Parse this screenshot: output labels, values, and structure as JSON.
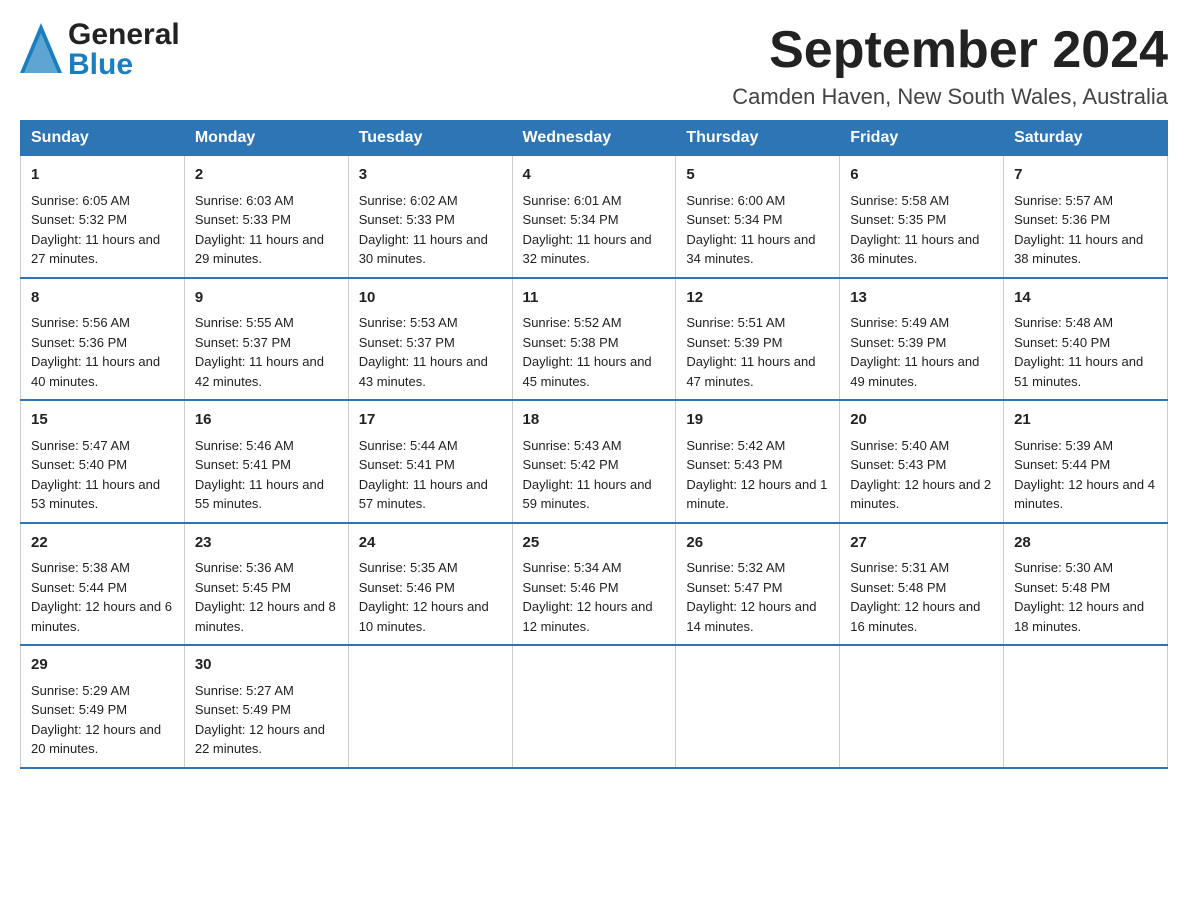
{
  "header": {
    "logo_general": "General",
    "logo_blue": "Blue",
    "month_title": "September 2024",
    "location": "Camden Haven, New South Wales, Australia"
  },
  "days_of_week": [
    "Sunday",
    "Monday",
    "Tuesday",
    "Wednesday",
    "Thursday",
    "Friday",
    "Saturday"
  ],
  "weeks": [
    [
      {
        "day": "1",
        "sunrise": "6:05 AM",
        "sunset": "5:32 PM",
        "daylight": "11 hours and 27 minutes."
      },
      {
        "day": "2",
        "sunrise": "6:03 AM",
        "sunset": "5:33 PM",
        "daylight": "11 hours and 29 minutes."
      },
      {
        "day": "3",
        "sunrise": "6:02 AM",
        "sunset": "5:33 PM",
        "daylight": "11 hours and 30 minutes."
      },
      {
        "day": "4",
        "sunrise": "6:01 AM",
        "sunset": "5:34 PM",
        "daylight": "11 hours and 32 minutes."
      },
      {
        "day": "5",
        "sunrise": "6:00 AM",
        "sunset": "5:34 PM",
        "daylight": "11 hours and 34 minutes."
      },
      {
        "day": "6",
        "sunrise": "5:58 AM",
        "sunset": "5:35 PM",
        "daylight": "11 hours and 36 minutes."
      },
      {
        "day": "7",
        "sunrise": "5:57 AM",
        "sunset": "5:36 PM",
        "daylight": "11 hours and 38 minutes."
      }
    ],
    [
      {
        "day": "8",
        "sunrise": "5:56 AM",
        "sunset": "5:36 PM",
        "daylight": "11 hours and 40 minutes."
      },
      {
        "day": "9",
        "sunrise": "5:55 AM",
        "sunset": "5:37 PM",
        "daylight": "11 hours and 42 minutes."
      },
      {
        "day": "10",
        "sunrise": "5:53 AM",
        "sunset": "5:37 PM",
        "daylight": "11 hours and 43 minutes."
      },
      {
        "day": "11",
        "sunrise": "5:52 AM",
        "sunset": "5:38 PM",
        "daylight": "11 hours and 45 minutes."
      },
      {
        "day": "12",
        "sunrise": "5:51 AM",
        "sunset": "5:39 PM",
        "daylight": "11 hours and 47 minutes."
      },
      {
        "day": "13",
        "sunrise": "5:49 AM",
        "sunset": "5:39 PM",
        "daylight": "11 hours and 49 minutes."
      },
      {
        "day": "14",
        "sunrise": "5:48 AM",
        "sunset": "5:40 PM",
        "daylight": "11 hours and 51 minutes."
      }
    ],
    [
      {
        "day": "15",
        "sunrise": "5:47 AM",
        "sunset": "5:40 PM",
        "daylight": "11 hours and 53 minutes."
      },
      {
        "day": "16",
        "sunrise": "5:46 AM",
        "sunset": "5:41 PM",
        "daylight": "11 hours and 55 minutes."
      },
      {
        "day": "17",
        "sunrise": "5:44 AM",
        "sunset": "5:41 PM",
        "daylight": "11 hours and 57 minutes."
      },
      {
        "day": "18",
        "sunrise": "5:43 AM",
        "sunset": "5:42 PM",
        "daylight": "11 hours and 59 minutes."
      },
      {
        "day": "19",
        "sunrise": "5:42 AM",
        "sunset": "5:43 PM",
        "daylight": "12 hours and 1 minute."
      },
      {
        "day": "20",
        "sunrise": "5:40 AM",
        "sunset": "5:43 PM",
        "daylight": "12 hours and 2 minutes."
      },
      {
        "day": "21",
        "sunrise": "5:39 AM",
        "sunset": "5:44 PM",
        "daylight": "12 hours and 4 minutes."
      }
    ],
    [
      {
        "day": "22",
        "sunrise": "5:38 AM",
        "sunset": "5:44 PM",
        "daylight": "12 hours and 6 minutes."
      },
      {
        "day": "23",
        "sunrise": "5:36 AM",
        "sunset": "5:45 PM",
        "daylight": "12 hours and 8 minutes."
      },
      {
        "day": "24",
        "sunrise": "5:35 AM",
        "sunset": "5:46 PM",
        "daylight": "12 hours and 10 minutes."
      },
      {
        "day": "25",
        "sunrise": "5:34 AM",
        "sunset": "5:46 PM",
        "daylight": "12 hours and 12 minutes."
      },
      {
        "day": "26",
        "sunrise": "5:32 AM",
        "sunset": "5:47 PM",
        "daylight": "12 hours and 14 minutes."
      },
      {
        "day": "27",
        "sunrise": "5:31 AM",
        "sunset": "5:48 PM",
        "daylight": "12 hours and 16 minutes."
      },
      {
        "day": "28",
        "sunrise": "5:30 AM",
        "sunset": "5:48 PM",
        "daylight": "12 hours and 18 minutes."
      }
    ],
    [
      {
        "day": "29",
        "sunrise": "5:29 AM",
        "sunset": "5:49 PM",
        "daylight": "12 hours and 20 minutes."
      },
      {
        "day": "30",
        "sunrise": "5:27 AM",
        "sunset": "5:49 PM",
        "daylight": "12 hours and 22 minutes."
      },
      null,
      null,
      null,
      null,
      null
    ]
  ]
}
